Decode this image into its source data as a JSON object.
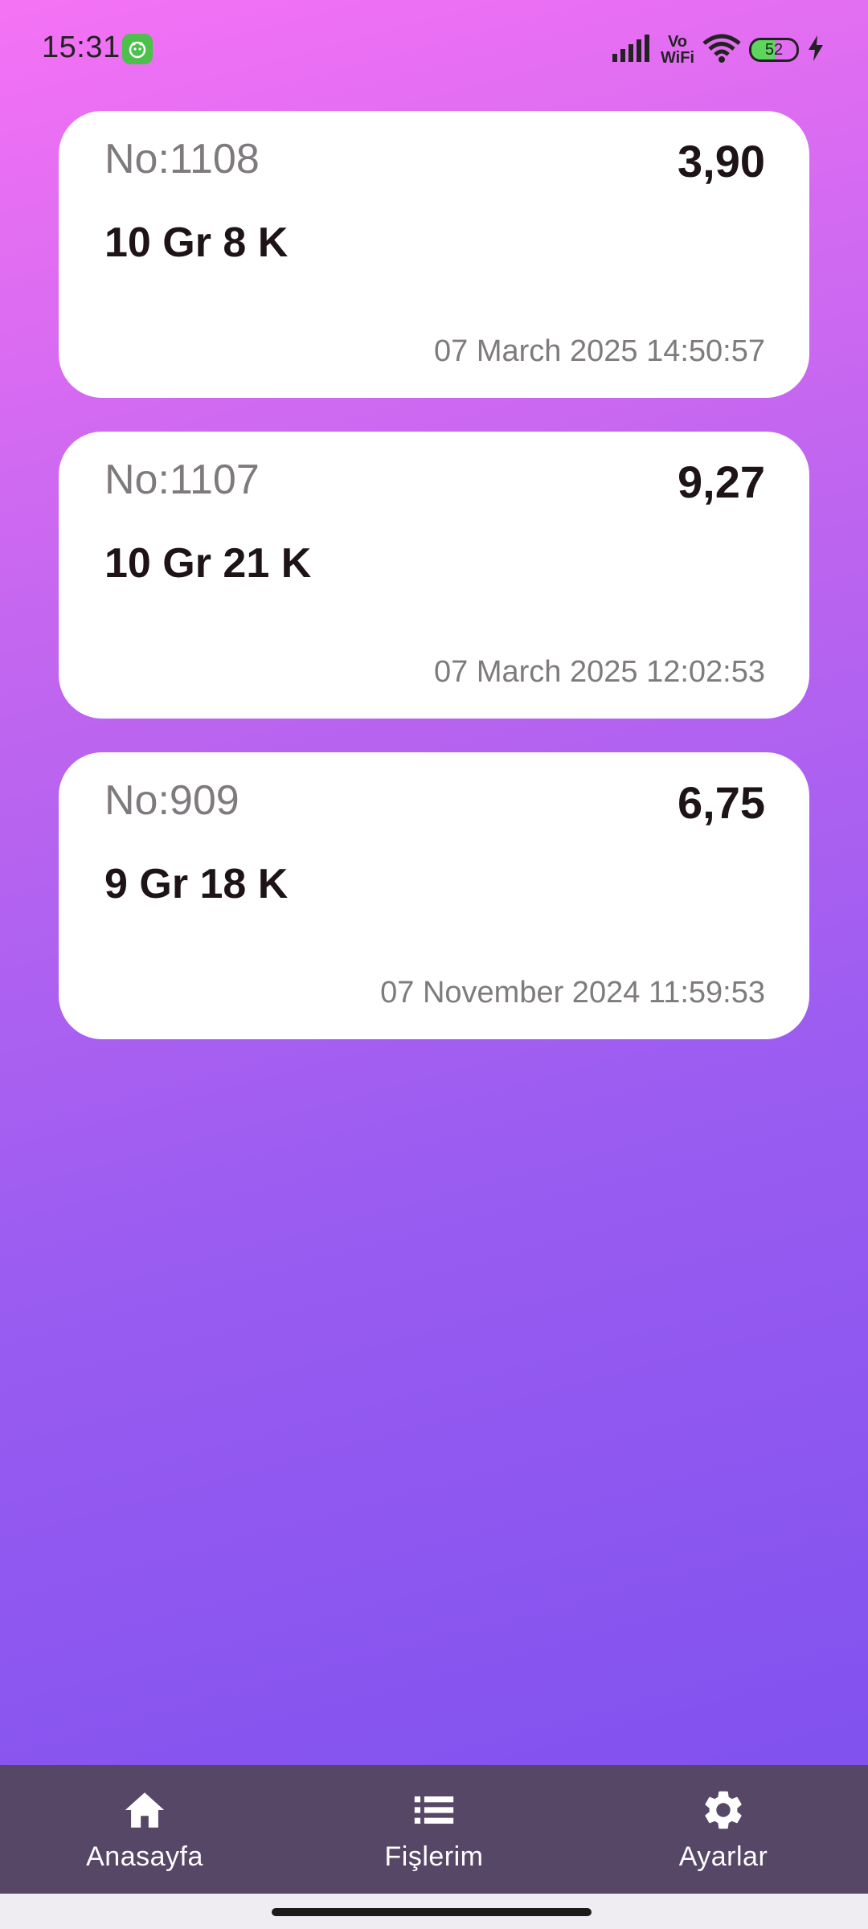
{
  "status_bar": {
    "time": "15:31",
    "network_label_top": "Vo",
    "network_label_bottom": "WiFi",
    "battery_level": "52",
    "icons": [
      "signal-icon",
      "wifi-icon",
      "battery-icon",
      "charging-icon"
    ]
  },
  "cards": [
    {
      "no": "No:1108",
      "amount": "3,90",
      "desc": "10 Gr 8 K",
      "date": "07 March 2025 14:50:57"
    },
    {
      "no": "No:1107",
      "amount": "9,27",
      "desc": "10 Gr 21 K",
      "date": "07 March 2025 12:02:53"
    },
    {
      "no": "No:909",
      "amount": "6,75",
      "desc": "9 Gr 18 K",
      "date": "07 November 2024 11:59:53"
    }
  ],
  "nav": {
    "home": {
      "label": "Anasayfa",
      "icon": "home-icon"
    },
    "receipts": {
      "label": "Fişlerim",
      "icon": "list-icon"
    },
    "settings": {
      "label": "Ayarlar",
      "icon": "gear-icon"
    }
  },
  "colors": {
    "gradient_top": "#f572f4",
    "gradient_bottom": "#7b4fee",
    "nav_background": "#574767",
    "card_background": "#ffffff"
  }
}
